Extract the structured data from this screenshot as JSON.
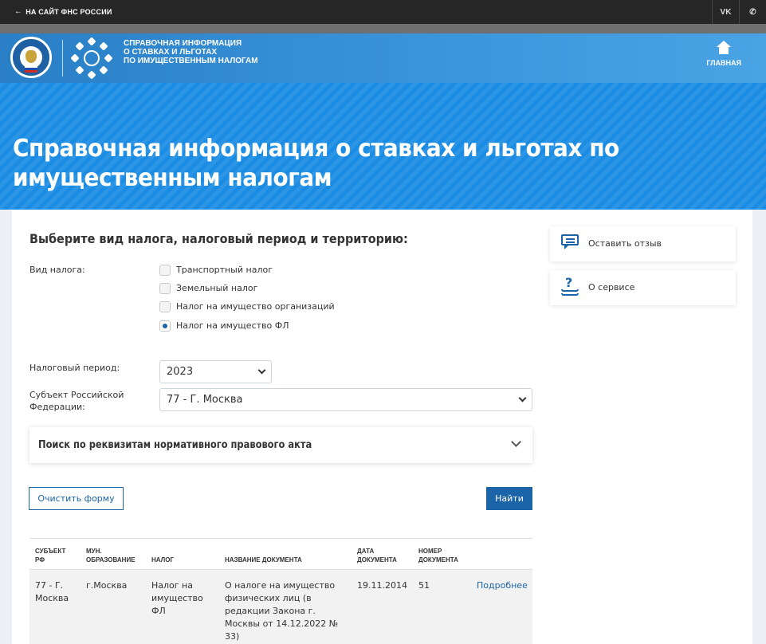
{
  "topbar": {
    "back_label": "НА САЙТ ФНС РОССИИ",
    "vk_label": "VK",
    "phone_label": "✆"
  },
  "header": {
    "title_line1": "СПРАВОЧНАЯ ИНФОРМАЦИЯ",
    "title_line2": "О СТАВКАХ И ЛЬГОТАХ",
    "title_line3": "ПО ИМУЩЕСТВЕННЫМ НАЛОГАМ",
    "home_label": "ГЛАВНАЯ"
  },
  "hero": {
    "title_line1": "Справочная информация о ставках и льготах по",
    "title_line2": "имущественным налогам"
  },
  "form": {
    "heading": "Выберите вид налога, налоговый период и территорию:",
    "tax_type_label": "Вид налога:",
    "tax_types": [
      {
        "label": "Транспортный налог",
        "selected": false
      },
      {
        "label": "Земельный налог",
        "selected": false
      },
      {
        "label": "Налог на имущество организаций",
        "selected": false
      },
      {
        "label": "Налог на имущество ФЛ",
        "selected": true
      }
    ],
    "period_label": "Налоговый период:",
    "period_value": "2023",
    "subject_label_line1": "Субъект Российской",
    "subject_label_line2": "Федерации:",
    "subject_value": "77 - Г. Москва",
    "search_by_act": "Поиск по реквизитам нормативного правового акта",
    "clear_button": "Очистить форму",
    "find_button": "Найти"
  },
  "table": {
    "headers": {
      "subject_l1": "Субъект",
      "subject_l2": "РФ",
      "mun_l1": "Мун.",
      "mun_l2": "образование",
      "tax": "Налог",
      "doc_name": "Название документа",
      "doc_date_l1": "Дата",
      "doc_date_l2": "документа",
      "doc_num_l1": "Номер",
      "doc_num_l2": "документа"
    },
    "row": {
      "subject_l1": "77 - Г.",
      "subject_l2": "Москва",
      "mun": "г.Москва",
      "tax_l1": "Налог на",
      "tax_l2": "имущество",
      "tax_l3": "ФЛ",
      "doc_l1": "О налоге на имущество",
      "doc_l2": "физических лиц (в",
      "doc_l3": "редакции Закона г.",
      "doc_l4": "Москвы от 14.12.2022 №",
      "doc_l5": "33)",
      "date": "19.11.2014",
      "number": "51",
      "details_link": "Подробнее"
    }
  },
  "sidebar": {
    "feedback_label": "Оставить отзыв",
    "about_label": "О сервисе"
  }
}
